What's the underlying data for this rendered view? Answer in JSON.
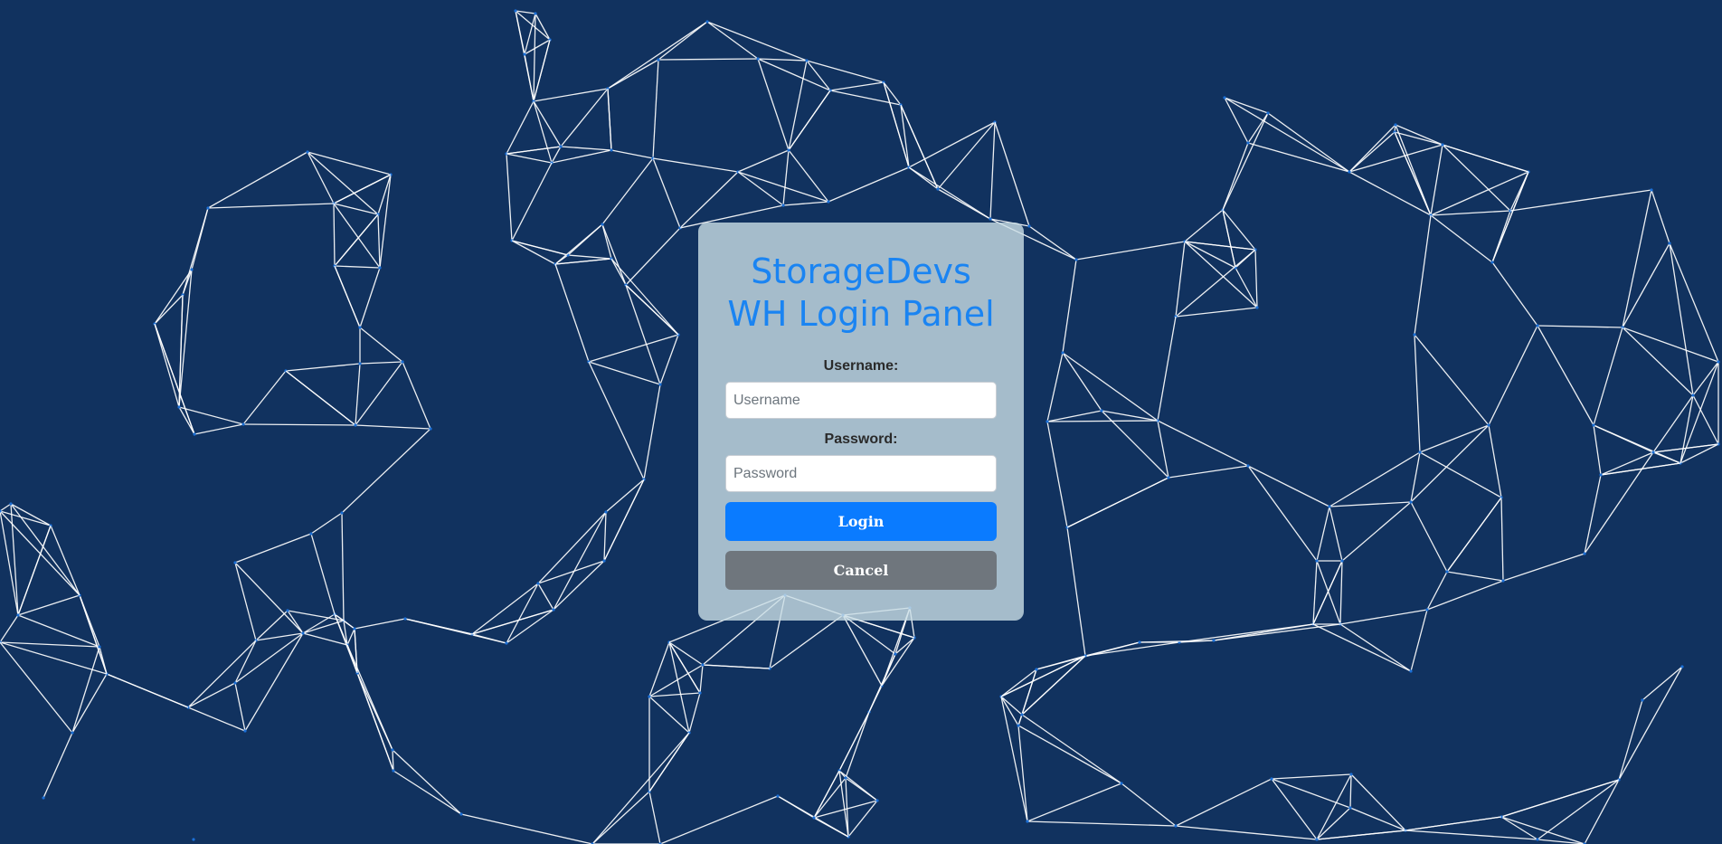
{
  "colors": {
    "background": "#11325f",
    "network_lines": "#ffffff",
    "title": "#1a84f2",
    "login_button": "#0a7bff",
    "cancel_button": "#6f767d"
  },
  "login_panel": {
    "title_line1": "StorageDevs",
    "title_line2": "WH Login Panel",
    "username_label": "Username:",
    "username_placeholder": "Username",
    "username_value": "",
    "password_label": "Password:",
    "password_placeholder": "Password",
    "password_value": "",
    "login_button": "Login",
    "cancel_button": "Cancel"
  }
}
